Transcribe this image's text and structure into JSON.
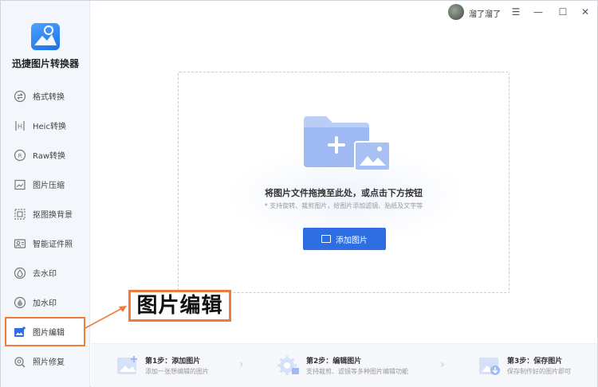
{
  "app": {
    "name": "迅捷图片转换器"
  },
  "sidebar": {
    "items": [
      {
        "label": "格式转换",
        "icon": "format-convert-icon"
      },
      {
        "label": "Heic转换",
        "icon": "heic-icon"
      },
      {
        "label": "Raw转换",
        "icon": "raw-icon"
      },
      {
        "label": "图片压缩",
        "icon": "compress-icon"
      },
      {
        "label": "抠图换背景",
        "icon": "cutout-icon"
      },
      {
        "label": "智能证件照",
        "icon": "id-photo-icon"
      },
      {
        "label": "去水印",
        "icon": "remove-watermark-icon"
      },
      {
        "label": "加水印",
        "icon": "add-watermark-icon"
      },
      {
        "label": "图片编辑",
        "icon": "image-edit-icon",
        "active": true
      },
      {
        "label": "照片修复",
        "icon": "photo-repair-icon"
      }
    ]
  },
  "topbar": {
    "username": "溜了溜了",
    "menu_icon": "☰",
    "minimize_icon": "—",
    "maximize_icon": "☐",
    "close_icon": "✕"
  },
  "dropzone": {
    "main_text": "将图片文件拖拽至此处，或点击下方按钮",
    "sub_text": "* 支持旋转、裁剪图片，给图片添加滤镜、贴纸及文字等",
    "button_label": "添加图片"
  },
  "annotation": {
    "label": "图片编辑",
    "color": "#ef7c3a"
  },
  "steps": [
    {
      "title": "第1步：添加图片",
      "desc": "添加一张想编辑的图片"
    },
    {
      "title": "第2步：编辑图片",
      "desc": "支持裁剪、滤镜等多种图片编辑功能"
    },
    {
      "title": "第3步：保存图片",
      "desc": "保存制作好的图片即可"
    }
  ],
  "colors": {
    "accent": "#2d6fe3",
    "highlight": "#ef7c3a"
  }
}
